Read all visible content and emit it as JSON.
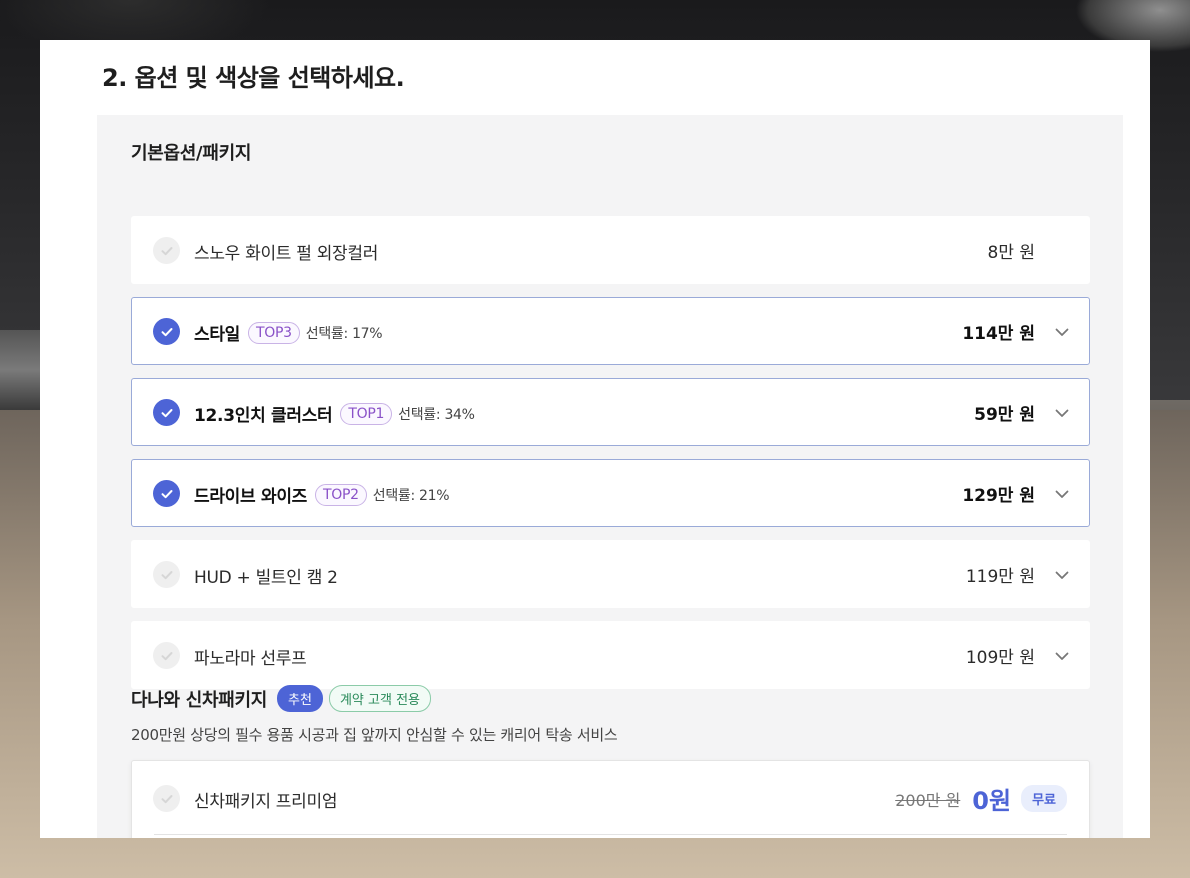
{
  "section_title": "2. 옵션 및 색상을 선택하세요.",
  "basic_group_title": "기본옵션/패키지",
  "options": [
    {
      "name": "스노우 화이트 펄 외장컬러",
      "price": "8만 원",
      "selected": false,
      "badge": "",
      "rate": "",
      "expandable": false
    },
    {
      "name": "스타일",
      "price": "114만 원",
      "selected": true,
      "badge": "TOP3",
      "rate": "선택률: 17%",
      "expandable": true
    },
    {
      "name": "12.3인치 클러스터",
      "price": "59만 원",
      "selected": true,
      "badge": "TOP1",
      "rate": "선택률: 34%",
      "expandable": true
    },
    {
      "name": "드라이브 와이즈",
      "price": "129만 원",
      "selected": true,
      "badge": "TOP2",
      "rate": "선택률: 21%",
      "expandable": true
    },
    {
      "name": "HUD + 빌트인 캠 2",
      "price": "119만 원",
      "selected": false,
      "badge": "",
      "rate": "",
      "expandable": true
    },
    {
      "name": "파노라마 선루프",
      "price": "109만 원",
      "selected": false,
      "badge": "",
      "rate": "",
      "expandable": true
    }
  ],
  "package": {
    "title": "다나와 신차패키지",
    "recommend_badge": "추천",
    "contract_badge": "계약 고객 전용",
    "description": "200만원 상당의 필수 용품 시공과 집 앞까지 안심할 수 있는 캐리어 탁송 서비스",
    "item_name": "신차패키지 프리미엄",
    "original_price": "200만 원",
    "price": "0원",
    "free_badge": "무료"
  },
  "colors": {
    "accent": "#4d64d6",
    "top_badge": "#8a52c8",
    "contract_badge": "#2a8a5a"
  },
  "icons": {
    "check": "check-circle-icon",
    "expand": "chevron-down-icon"
  }
}
